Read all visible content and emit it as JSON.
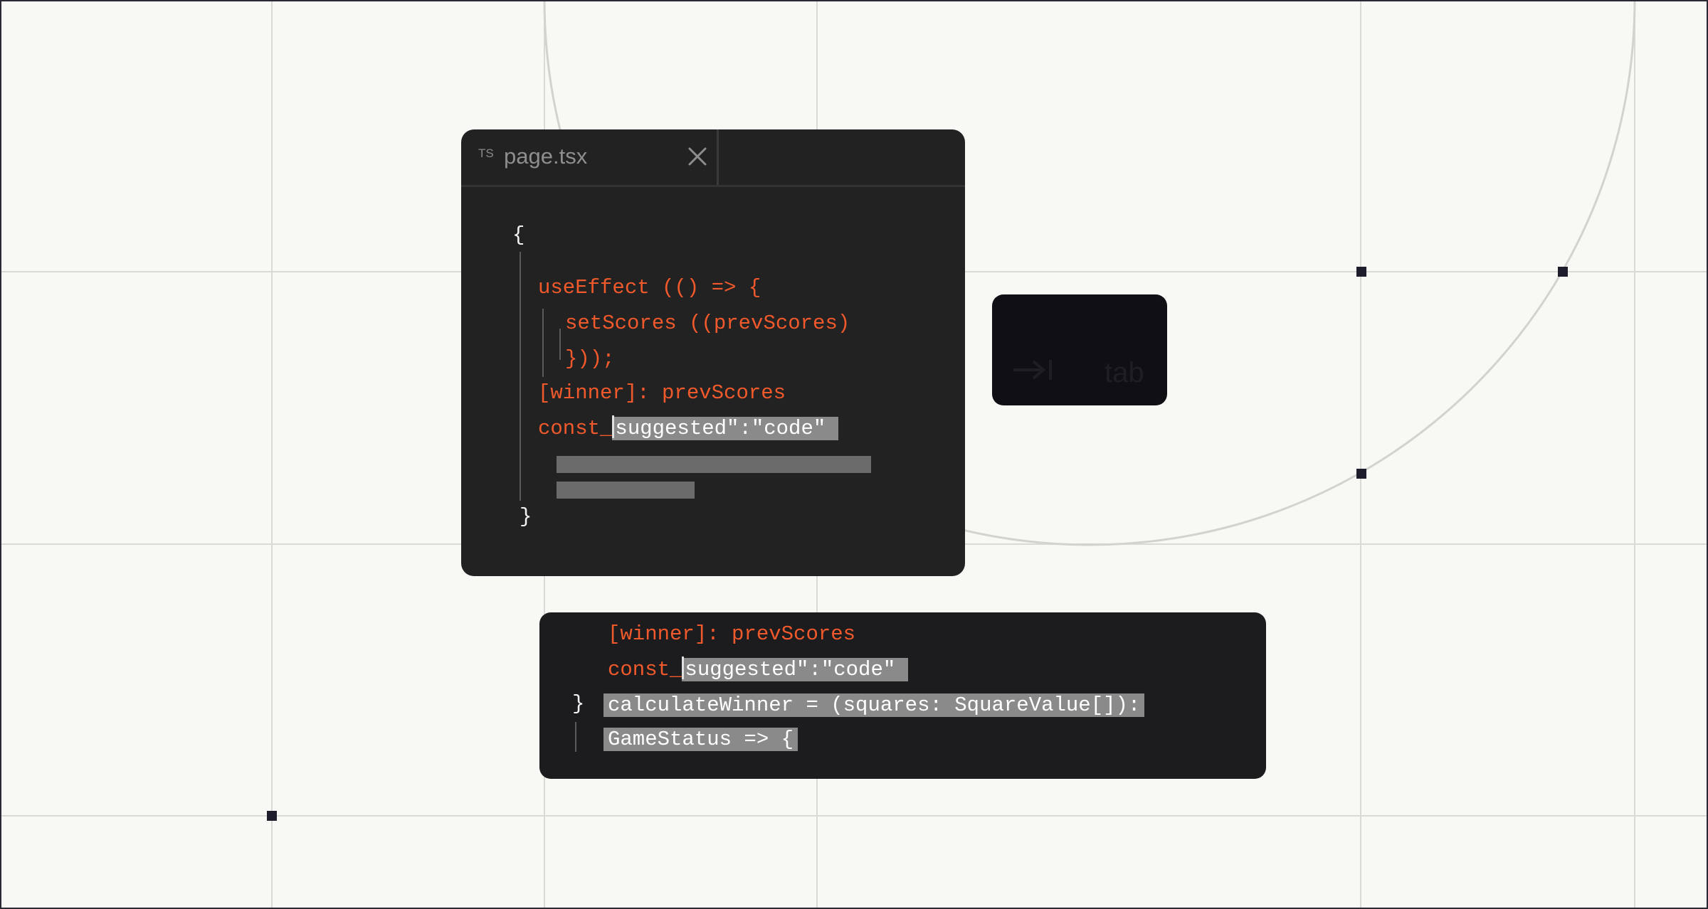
{
  "editor": {
    "tab": {
      "lang_badge": "TS",
      "filename": "page.tsx",
      "close_icon": "close-icon"
    },
    "code": {
      "open_brace": "{",
      "use_effect": "useEffect (() => {",
      "set_scores": "setScores ((prevScores)",
      "close_paren": "}));",
      "winner": "[winner]: prevScores",
      "const_prefix": "const_",
      "suggestion": "suggested\":\"code\"",
      "close_brace": "}"
    }
  },
  "tab_hint": {
    "icon": "tab-key-arrow-icon",
    "label": "tab"
  },
  "popup": {
    "winner": "[winner]: prevScores",
    "const_prefix": "const_",
    "suggestion": "suggested\":\"code\"",
    "close_brace": "}",
    "line_calc": "calculateWinner = (squares: SquareValue[]):",
    "line_status": "GameStatus => {"
  },
  "colors": {
    "keyword": "#f0592b",
    "editor_bg": "#222222",
    "popup_bg": "#1c1c1f",
    "selection": "#8a8a8a"
  }
}
